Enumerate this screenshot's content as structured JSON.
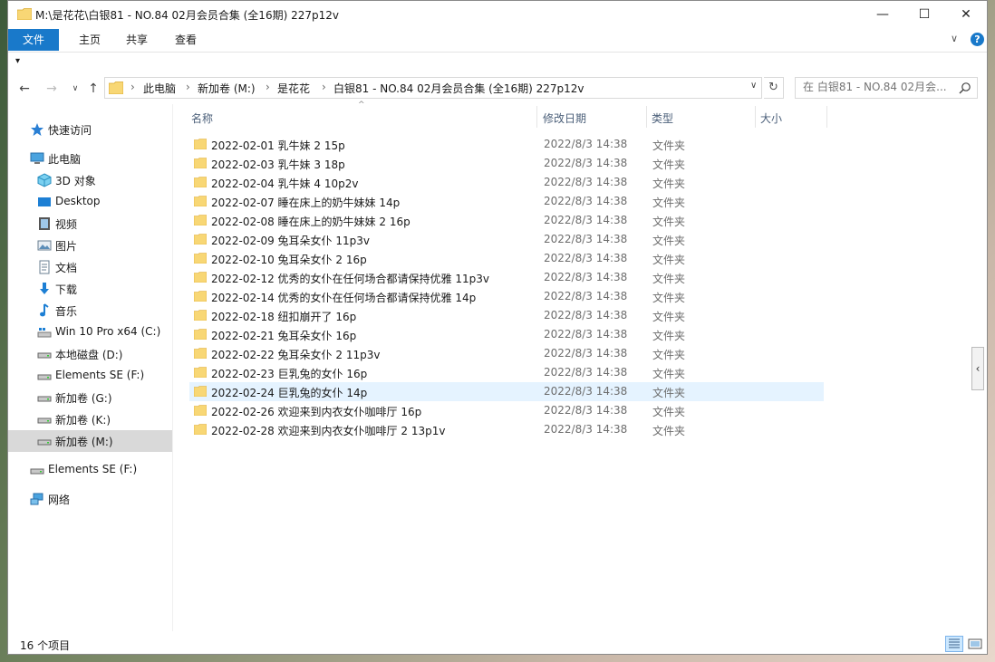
{
  "window": {
    "title": "M:\\是花花\\白银81 - NO.84 02月会员合集 (全16期) 227p12v",
    "controls": {
      "minimize": "—",
      "maximize": "☐",
      "close": "✕"
    }
  },
  "ribbon": {
    "tabs": [
      "文件",
      "主页",
      "共享",
      "查看"
    ],
    "collapse_glyph": "∨",
    "help_glyph": "?",
    "qat_glyph": "▾"
  },
  "nav": {
    "back": "←",
    "forward": "→",
    "recent": "∨",
    "up": "↑"
  },
  "address": {
    "crumbs": [
      "此电脑",
      "新加卷 (M:)",
      "是花花",
      "白银81 - NO.84 02月会员合集 (全16期) 227p12v"
    ],
    "separator": "›",
    "dropdown": "∨",
    "refresh": "↻"
  },
  "search": {
    "placeholder": "在 白银81 - NO.84 02月会..."
  },
  "navpane": {
    "items": [
      {
        "label": "快速访问",
        "icon": "star-icon"
      },
      {
        "label": "此电脑",
        "icon": "computer-icon"
      },
      {
        "label": "3D 对象",
        "icon": "cube-icon"
      },
      {
        "label": "Desktop",
        "icon": "desktop-icon"
      },
      {
        "label": "视频",
        "icon": "video-icon"
      },
      {
        "label": "图片",
        "icon": "picture-icon"
      },
      {
        "label": "文档",
        "icon": "document-icon"
      },
      {
        "label": "下载",
        "icon": "download-icon"
      },
      {
        "label": "音乐",
        "icon": "music-icon"
      },
      {
        "label": "Win 10 Pro x64 (C:)",
        "icon": "system-drive-icon"
      },
      {
        "label": "本地磁盘 (D:)",
        "icon": "drive-icon"
      },
      {
        "label": "Elements SE (F:)",
        "icon": "drive-icon"
      },
      {
        "label": "新加卷 (G:)",
        "icon": "drive-icon"
      },
      {
        "label": "新加卷 (K:)",
        "icon": "drive-icon"
      },
      {
        "label": "新加卷 (M:)",
        "icon": "drive-icon"
      },
      {
        "label": "Elements SE (F:)",
        "icon": "drive-icon"
      },
      {
        "label": "网络",
        "icon": "network-icon"
      }
    ]
  },
  "columns": [
    "名称",
    "修改日期",
    "类型",
    "大小"
  ],
  "files": [
    {
      "name": "2022-02-01 乳牛妹 2 15p",
      "date": "2022/8/3 14:38",
      "type": "文件夹"
    },
    {
      "name": "2022-02-03 乳牛妹 3 18p",
      "date": "2022/8/3 14:38",
      "type": "文件夹"
    },
    {
      "name": "2022-02-04 乳牛妹 4 10p2v",
      "date": "2022/8/3 14:38",
      "type": "文件夹"
    },
    {
      "name": "2022-02-07 睡在床上的奶牛妹妹 14p",
      "date": "2022/8/3 14:38",
      "type": "文件夹"
    },
    {
      "name": "2022-02-08 睡在床上的奶牛妹妹 2 16p",
      "date": "2022/8/3 14:38",
      "type": "文件夹"
    },
    {
      "name": "2022-02-09 兔耳朵女仆 11p3v",
      "date": "2022/8/3 14:38",
      "type": "文件夹"
    },
    {
      "name": "2022-02-10 兔耳朵女仆 2 16p",
      "date": "2022/8/3 14:38",
      "type": "文件夹"
    },
    {
      "name": "2022-02-12 优秀的女仆在任何场合都请保持优雅 11p3v",
      "date": "2022/8/3 14:38",
      "type": "文件夹"
    },
    {
      "name": "2022-02-14 优秀的女仆在任何场合都请保持优雅 14p",
      "date": "2022/8/3 14:38",
      "type": "文件夹"
    },
    {
      "name": "2022-02-18 纽扣崩开了 16p",
      "date": "2022/8/3 14:38",
      "type": "文件夹"
    },
    {
      "name": "2022-02-21 兔耳朵女仆 16p",
      "date": "2022/8/3 14:38",
      "type": "文件夹"
    },
    {
      "name": "2022-02-22 兔耳朵女仆 2 11p3v",
      "date": "2022/8/3 14:38",
      "type": "文件夹"
    },
    {
      "name": "2022-02-23 巨乳兔的女仆 16p",
      "date": "2022/8/3 14:38",
      "type": "文件夹"
    },
    {
      "name": "2022-02-24 巨乳兔的女仆 14p",
      "date": "2022/8/3 14:38",
      "type": "文件夹"
    },
    {
      "name": "2022-02-26 欢迎来到内衣女仆咖啡厅 16p",
      "date": "2022/8/3 14:38",
      "type": "文件夹"
    },
    {
      "name": "2022-02-28 欢迎来到内衣女仆咖啡厅 2 13p1v",
      "date": "2022/8/3 14:38",
      "type": "文件夹"
    }
  ],
  "hovered_row": 13,
  "selected_nav": 14,
  "status": {
    "count": "16 个项目"
  },
  "preview_toggle": "‹",
  "colors": {
    "accent": "#1979ca",
    "folder": "#f8d775",
    "hover": "#e5f3ff",
    "selected": "#d9d9d9"
  }
}
